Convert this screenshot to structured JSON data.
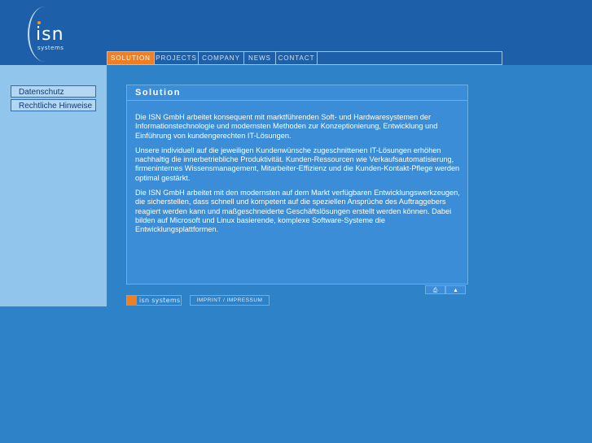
{
  "brand": {
    "logo_text": "isn",
    "logo_sub": "systems",
    "footer_name": "isn systems"
  },
  "nav": {
    "items": [
      {
        "label": "SOLUTION",
        "active": true
      },
      {
        "label": "PROJECTS",
        "active": false
      },
      {
        "label": "COMPANY",
        "active": false
      },
      {
        "label": "NEWS",
        "active": false
      },
      {
        "label": "CONTACT",
        "active": false
      }
    ]
  },
  "sidebar": {
    "items": [
      {
        "label": "Datenschutz"
      },
      {
        "label": "Rechtliche Hinweise"
      }
    ]
  },
  "content": {
    "title": "Solution",
    "paragraphs": [
      "Die ISN GmbH arbeitet konsequent mit marktführenden Soft- und Hardwaresystemen der Informationstechnologie und modernsten Methoden zur Konzeptionierung, Entwicklung und Einführung von kundengerechten IT-Lösungen.",
      "Unsere individuell auf die jeweiligen Kundenwünsche zugeschnittenen IT-Lösungen erhöhen nachhaltig die innerbetriebliche Produktivität. Kunden-Ressourcen wie Verkaufsautomatisierung, firmeninternes Wissensmanagement, Mitarbeiter-Effizienz und die Kunden-Kontakt-Pflege werden optimal gestärkt.",
      "Die ISN GmbH arbeitet mit den modernsten auf dem Markt verfügbaren Entwicklungswerkzeugen, die sicherstellen, dass schnell und kompetent auf die speziellen Ansprüche des Auftraggebers reagiert werden kann und maßgeschneiderte Geschäftslösungen erstellt werden können. Dabei bilden auf Microsoft und Linux basierende, komplexe Software-Systeme die Entwicklungsplattformen."
    ]
  },
  "tools": {
    "print_icon": "⎙",
    "top_icon": "▲"
  },
  "footer": {
    "imprint_label": "IMPRINT / IMPRESSUM"
  },
  "colors": {
    "background": "#2e82c8",
    "header": "#1d5fa8",
    "accent": "#f07e22",
    "sidebar": "#92c5ec"
  }
}
